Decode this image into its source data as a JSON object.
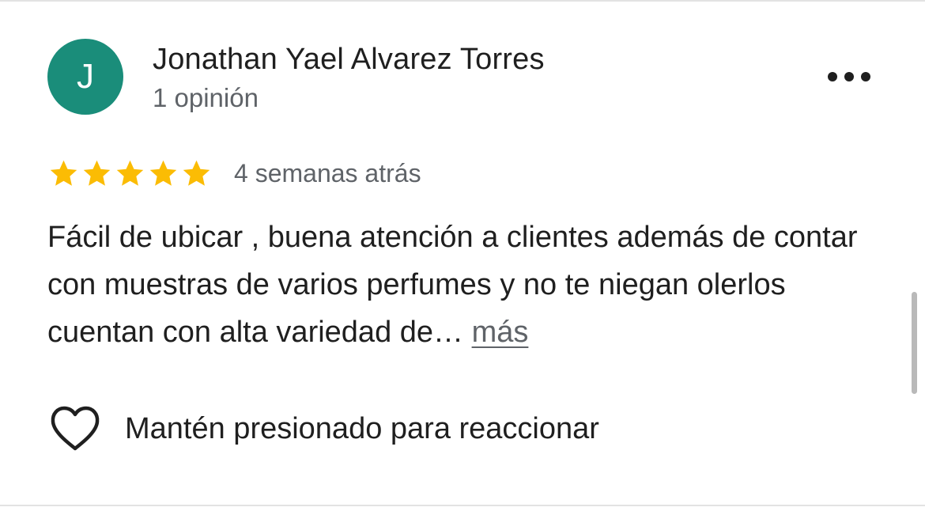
{
  "review": {
    "author": {
      "initial": "J",
      "name": "Jonathan Yael Alvarez Torres",
      "meta": "1 opinión",
      "avatar_color": "#1a8d7a"
    },
    "rating": 5,
    "star_color": "#fbbc04",
    "date": "4 semanas atrás",
    "text": "Fácil de ubicar , buena atención a clientes además de contar con muestras de varios perfumes y no te niegan olerlos cuentan con alta variedad de…",
    "more_label": "más",
    "react_label": "Mantén presionado para reaccionar"
  },
  "icons": {
    "more_options": "more-horizontal-icon",
    "star": "star-icon",
    "heart": "heart-outline-icon"
  }
}
